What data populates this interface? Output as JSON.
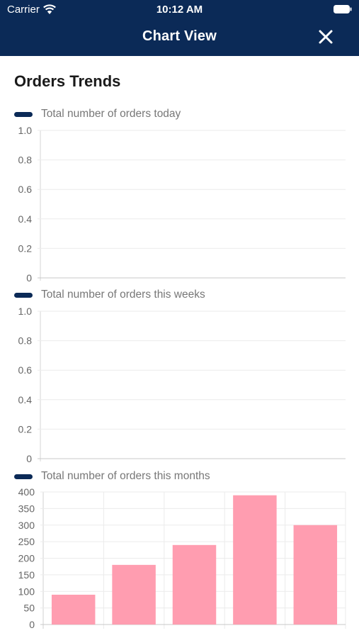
{
  "status_bar": {
    "carrier": "Carrier",
    "time": "10:12 AM",
    "wifi_icon": "wifi-icon",
    "battery_icon": "battery-icon"
  },
  "header": {
    "title": "Chart View",
    "close_icon": "close-icon",
    "background": "#0b2a57"
  },
  "page_title": "Orders Trends",
  "chart_data": [
    {
      "type": "line",
      "series": [
        {
          "name": "Total number of orders today",
          "values": []
        }
      ],
      "yticks": [
        "1.0",
        "0.8",
        "0.6",
        "0.4",
        "0.2",
        "0"
      ],
      "ylim": [
        0,
        1
      ],
      "grid": true,
      "legend": "top-left",
      "series_color": "#0b2a57"
    },
    {
      "type": "line",
      "series": [
        {
          "name": "Total number of orders this weeks",
          "values": []
        }
      ],
      "yticks": [
        "1.0",
        "0.8",
        "0.6",
        "0.4",
        "0.2",
        "0"
      ],
      "ylim": [
        0,
        1
      ],
      "grid": true,
      "legend": "top-left",
      "series_color": "#0b2a57"
    },
    {
      "type": "bar",
      "series": [
        {
          "name": "Total number of orders this months",
          "values": [
            90,
            180,
            240,
            390,
            300
          ]
        }
      ],
      "yticks": [
        "400",
        "350",
        "300",
        "250",
        "200",
        "150",
        "100",
        "50",
        "0"
      ],
      "ylim": [
        0,
        400
      ],
      "grid": true,
      "legend": "top-left",
      "legend_color": "#0b2a57",
      "bar_color": "#ff9db0"
    }
  ]
}
